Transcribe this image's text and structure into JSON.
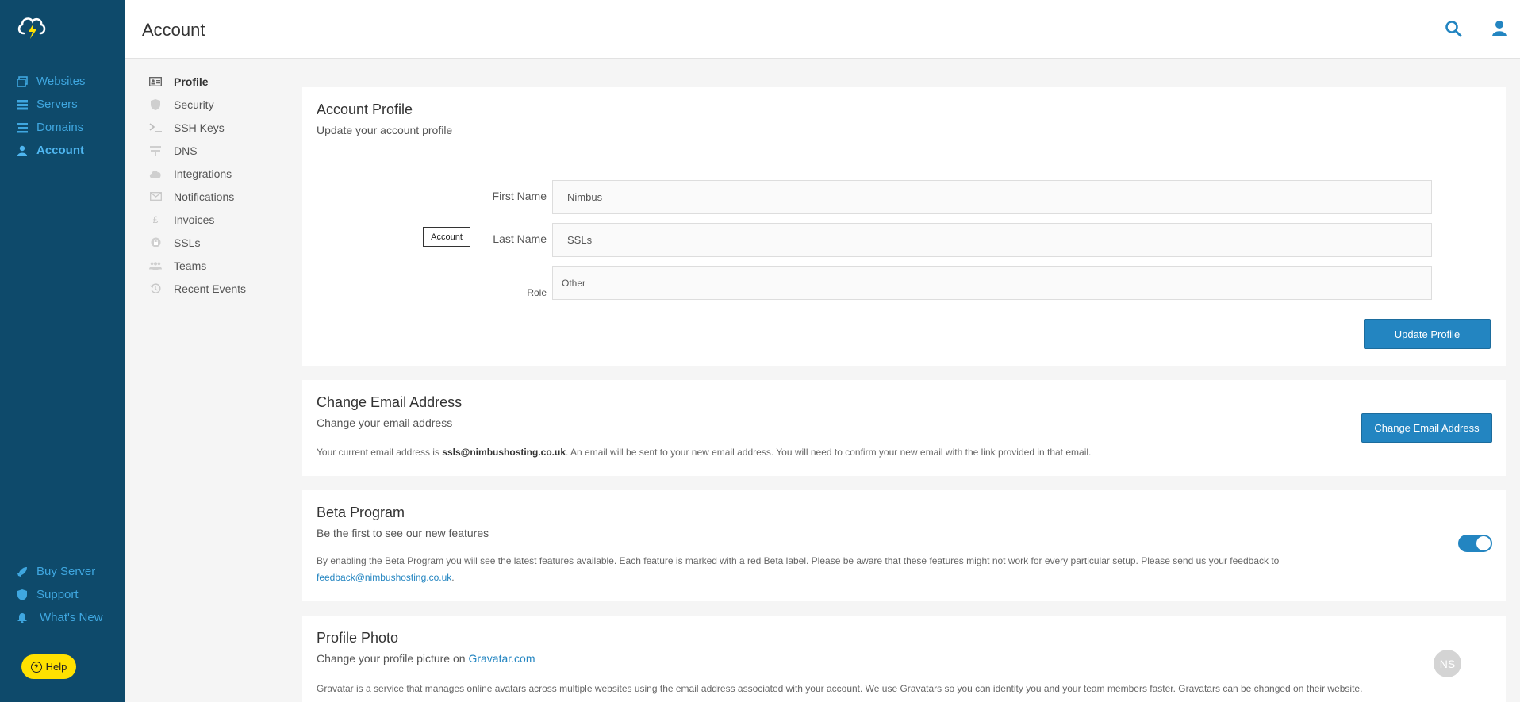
{
  "app": {
    "page_title": "Account"
  },
  "sidebar": {
    "items": [
      {
        "label": "Websites",
        "icon": "websites-icon"
      },
      {
        "label": "Servers",
        "icon": "servers-icon"
      },
      {
        "label": "Domains",
        "icon": "domains-icon"
      },
      {
        "label": "Account",
        "icon": "user-icon",
        "active": true
      }
    ],
    "bottom_items": [
      {
        "label": "Buy Server",
        "icon": "rocket-icon"
      },
      {
        "label": "Support",
        "icon": "support-shield-icon"
      },
      {
        "label": "What's New",
        "icon": "bell-icon"
      }
    ],
    "help_label": "Help"
  },
  "subnav": {
    "items": [
      {
        "label": "Profile",
        "icon": "id-card-icon",
        "active": true
      },
      {
        "label": "Security",
        "icon": "shield-icon"
      },
      {
        "label": "SSH Keys",
        "icon": "terminal-icon"
      },
      {
        "label": "DNS",
        "icon": "signpost-icon"
      },
      {
        "label": "Integrations",
        "icon": "cloud-icon"
      },
      {
        "label": "Notifications",
        "icon": "envelope-icon"
      },
      {
        "label": "Invoices",
        "icon": "pound-icon"
      },
      {
        "label": "SSLs",
        "icon": "lock-icon"
      },
      {
        "label": "Teams",
        "icon": "team-icon"
      },
      {
        "label": "Recent Events",
        "icon": "history-icon"
      }
    ]
  },
  "profile": {
    "title": "Account Profile",
    "subtitle": "Update your account profile",
    "tag": "Account",
    "first_name_label": "First Name",
    "first_name_value": "Nimbus",
    "last_name_label": "Last Name",
    "last_name_value": "SSLs",
    "role_label": "Role",
    "role_value": "Other",
    "update_button": "Update Profile"
  },
  "email": {
    "title": "Change Email Address",
    "subtitle": "Change your email address",
    "desc_prefix": "Your current email address is ",
    "current_email": "ssls@nimbushosting.co.uk",
    "desc_suffix": ". An email will be sent to your new email address. You will need to confirm your new email with the link provided in that email.",
    "button": "Change Email Address"
  },
  "beta": {
    "title": "Beta Program",
    "subtitle": "Be the first to see our new features",
    "desc": "By enabling the Beta Program you will see the latest features available. Each feature is marked with a red Beta label. Please be aware that these features might not work for every particular setup. Please send us your feedback to",
    "feedback_email": "feedback@nimbushosting.co.uk",
    "desc_end": ".",
    "enabled": true
  },
  "photo": {
    "title": "Profile Photo",
    "subtitle_prefix": "Change your profile picture on ",
    "gravatar_link": "Gravatar.com",
    "desc": "Gravatar is a service that manages online avatars across multiple websites using the email address associated with your account. We use Gravatars so you can identity you and your team members faster. Gravatars can be changed on their website.",
    "avatar_initials": "NS"
  },
  "colors": {
    "sidebar_bg": "#0e4a6b",
    "accent": "#2385c1",
    "help_bg": "#ffe100"
  }
}
